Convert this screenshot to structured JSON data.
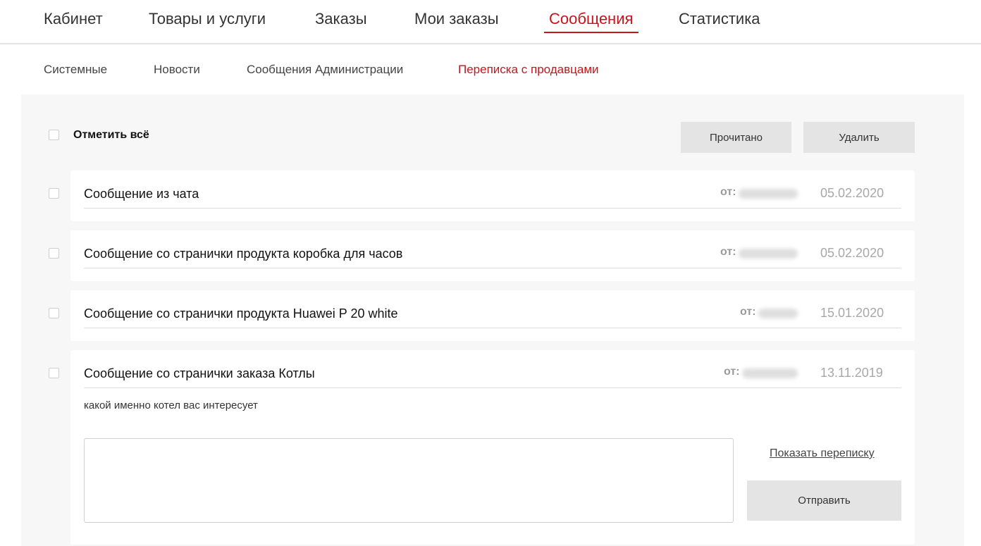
{
  "topnav": {
    "items": [
      {
        "label": "Кабинет"
      },
      {
        "label": "Товары и услуги"
      },
      {
        "label": "Заказы"
      },
      {
        "label": "Мои заказы"
      },
      {
        "label": "Сообщения",
        "active": true
      },
      {
        "label": "Статистика"
      }
    ]
  },
  "subnav": {
    "items": [
      {
        "label": "Системные"
      },
      {
        "label": "Новости"
      },
      {
        "label": "Сообщения Администрации"
      },
      {
        "label": "Переписка с продавцами",
        "active": true
      }
    ]
  },
  "toolbar": {
    "select_all_label": "Отметить всё",
    "read_label": "Прочитано",
    "delete_label": "Удалить"
  },
  "messages": [
    {
      "subject": "Сообщение из чата",
      "from_label": "от:",
      "date": "05.02.2020"
    },
    {
      "subject": "Сообщение со странички продукта коробка для часов",
      "from_label": "от:",
      "date": "05.02.2020"
    },
    {
      "subject": "Сообщение со странички продукта Huawei P 20 white",
      "from_label": "от:",
      "date": "15.01.2020"
    },
    {
      "subject": "Сообщение со странички заказа Котлы",
      "from_label": "от:",
      "date": "13.11.2019",
      "body": "какой именно котел вас интересует"
    }
  ],
  "expanded": {
    "reply_value": "",
    "show_thread_label": "Показать переписку",
    "send_label": "Отправить"
  },
  "colors": {
    "accent": "#c4161c",
    "panel_bg": "#f7f7f7",
    "button_bg": "#e4e4e4"
  }
}
